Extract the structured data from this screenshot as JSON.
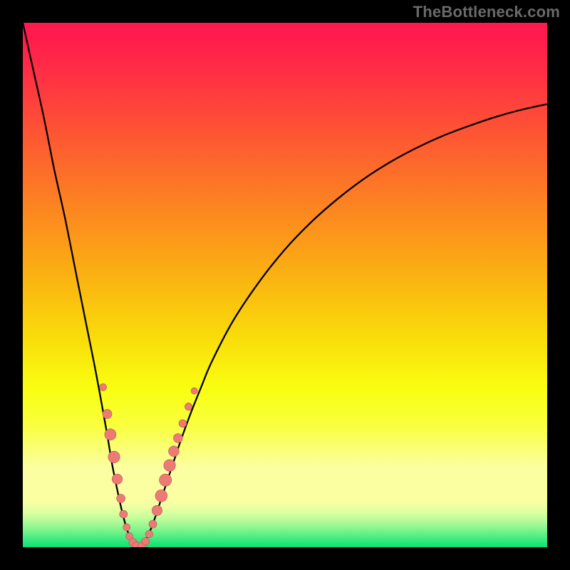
{
  "watermark": "TheBottleneck.com",
  "chart_data": {
    "type": "line",
    "title": "",
    "xlabel": "",
    "ylabel": "",
    "xlim": [
      0,
      100
    ],
    "ylim": [
      0,
      100
    ],
    "x_min_at": 22,
    "annotations": [],
    "series": [
      {
        "name": "bottleneck-curve",
        "color": "#000000",
        "x": [
          0,
          2,
          4,
          6,
          8,
          10,
          12,
          14,
          16,
          17,
          18,
          19,
          20,
          21,
          22,
          23,
          24,
          25,
          26,
          28,
          30,
          32,
          34,
          36,
          40,
          45,
          50,
          55,
          60,
          65,
          70,
          75,
          80,
          85,
          90,
          95,
          100
        ],
        "y": [
          100,
          91,
          82,
          72,
          63,
          53,
          43,
          33,
          22,
          16,
          11,
          6.5,
          3.0,
          0.8,
          0,
          0.8,
          2.5,
          5.0,
          8.0,
          14.0,
          20.0,
          25.5,
          30.5,
          35.3,
          43.0,
          50.5,
          56.8,
          62.0,
          66.4,
          70.2,
          73.4,
          76.1,
          78.4,
          80.3,
          82.0,
          83.4,
          84.5
        ]
      }
    ],
    "markers": {
      "name": "data-points-cluster",
      "color": "#ed7a74",
      "outline": "#ae5659",
      "points": [
        {
          "x": 15.3,
          "y": 30.5,
          "r": 5
        },
        {
          "x": 16.1,
          "y": 25.4,
          "r": 6.5
        },
        {
          "x": 16.7,
          "y": 21.5,
          "r": 8
        },
        {
          "x": 17.4,
          "y": 17.2,
          "r": 8.2
        },
        {
          "x": 18.0,
          "y": 13.0,
          "r": 7.2
        },
        {
          "x": 18.7,
          "y": 9.3,
          "r": 6
        },
        {
          "x": 19.2,
          "y": 6.3,
          "r": 5.5
        },
        {
          "x": 19.8,
          "y": 3.8,
          "r": 5
        },
        {
          "x": 20.3,
          "y": 2.1,
          "r": 5
        },
        {
          "x": 21.0,
          "y": 0.9,
          "r": 5.8
        },
        {
          "x": 21.7,
          "y": 0.2,
          "r": 5.8
        },
        {
          "x": 22.7,
          "y": 0.2,
          "r": 5.8
        },
        {
          "x": 23.4,
          "y": 1.1,
          "r": 5.4
        },
        {
          "x": 24.1,
          "y": 2.5,
          "r": 5.2
        },
        {
          "x": 24.8,
          "y": 4.4,
          "r": 5.5
        },
        {
          "x": 25.6,
          "y": 7.0,
          "r": 7.2
        },
        {
          "x": 26.4,
          "y": 9.8,
          "r": 8.4
        },
        {
          "x": 27.2,
          "y": 12.8,
          "r": 8.6
        },
        {
          "x": 28.0,
          "y": 15.6,
          "r": 8.2
        },
        {
          "x": 28.8,
          "y": 18.3,
          "r": 7.4
        },
        {
          "x": 29.6,
          "y": 20.8,
          "r": 6.4
        },
        {
          "x": 30.5,
          "y": 23.6,
          "r": 5.4
        },
        {
          "x": 31.6,
          "y": 26.8,
          "r": 5.2
        },
        {
          "x": 32.7,
          "y": 29.8,
          "r": 4.6
        }
      ]
    },
    "gradient_stops": [
      {
        "offset": 0.0,
        "color": "#ff1a4e"
      },
      {
        "offset": 0.03,
        "color": "#ff1c4c"
      },
      {
        "offset": 0.1,
        "color": "#ff3044"
      },
      {
        "offset": 0.2,
        "color": "#fe5135"
      },
      {
        "offset": 0.3,
        "color": "#fd7327"
      },
      {
        "offset": 0.4,
        "color": "#fc951b"
      },
      {
        "offset": 0.5,
        "color": "#fab810"
      },
      {
        "offset": 0.6,
        "color": "#f9dc0a"
      },
      {
        "offset": 0.7,
        "color": "#f9ff11"
      },
      {
        "offset": 0.77,
        "color": "#f9ff3f"
      },
      {
        "offset": 0.815,
        "color": "#faff7a"
      },
      {
        "offset": 0.85,
        "color": "#fbffa2"
      },
      {
        "offset": 0.88,
        "color": "#fbffa2"
      },
      {
        "offset": 0.905,
        "color": "#fbffa1"
      },
      {
        "offset": 0.92,
        "color": "#f1ffa2"
      },
      {
        "offset": 0.935,
        "color": "#d8ff9f"
      },
      {
        "offset": 0.95,
        "color": "#b4fb98"
      },
      {
        "offset": 0.965,
        "color": "#86f58e"
      },
      {
        "offset": 0.98,
        "color": "#4eed82"
      },
      {
        "offset": 1.0,
        "color": "#09e374"
      }
    ]
  }
}
